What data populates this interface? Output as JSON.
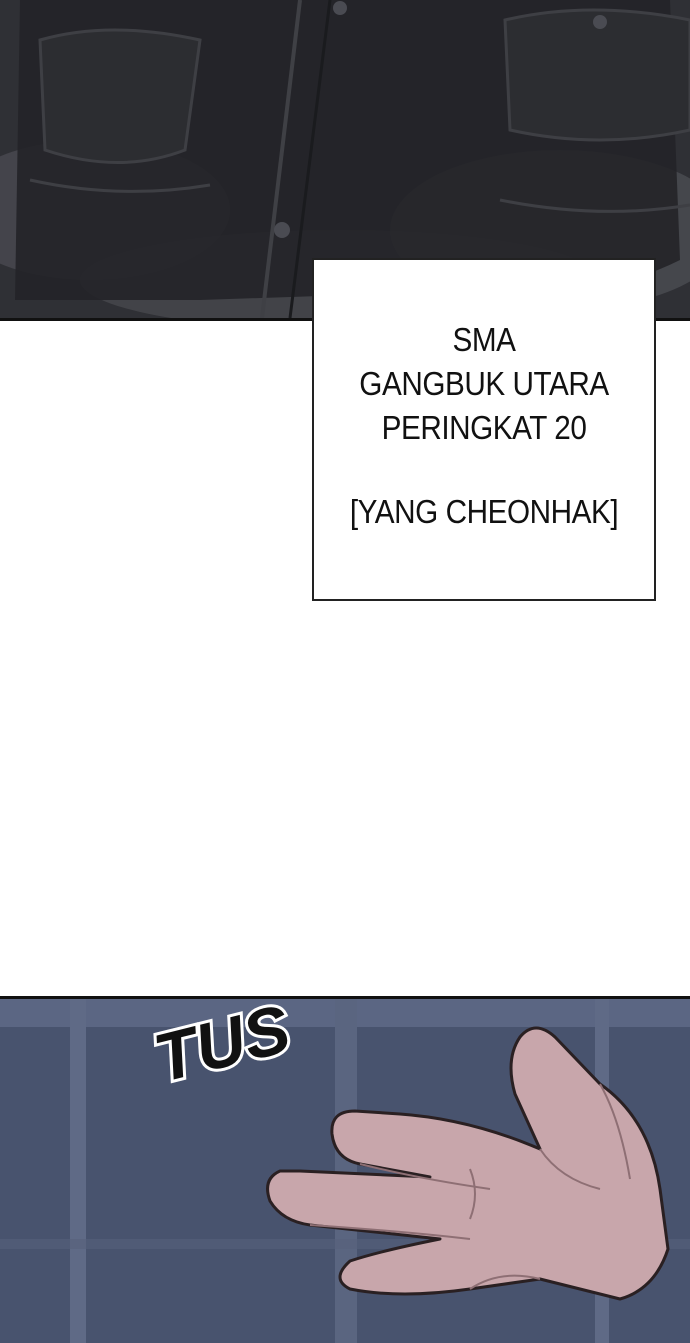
{
  "caption": {
    "lines": [
      "SMA",
      "GANGBUK UTARA",
      "PERINGKAT 20"
    ],
    "name": "[YANG CHEONHAK]"
  },
  "sfx": {
    "text": "TUS"
  },
  "colors": {
    "top_panel": "#2e2f34",
    "bottom_panel": "#4b5773",
    "skin": "#c9a8ad",
    "caption_border": "#222222"
  }
}
